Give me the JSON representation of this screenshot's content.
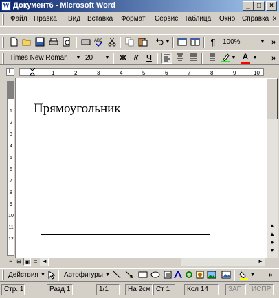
{
  "window": {
    "title": "Документ6 - Microsoft Word",
    "minimize": "_",
    "maximize": "□",
    "close": "×"
  },
  "menu": {
    "items": [
      "Файл",
      "Правка",
      "Вид",
      "Вставка",
      "Формат",
      "Сервис",
      "Таблица",
      "Окно",
      "Справка"
    ],
    "close_doc": "×",
    "more": "»"
  },
  "standard_toolbar": {
    "icons": [
      "new-icon",
      "open-icon",
      "save-icon",
      "print-icon",
      "print-preview-icon",
      "spelling-icon",
      "copy-icon",
      "paste-icon",
      "undo-icon",
      "table-icon",
      "columns-icon",
      "pilcrow-icon"
    ],
    "pilcrow": "¶",
    "zoom": "100%",
    "more": "»"
  },
  "format_toolbar": {
    "font": "Times New Roman",
    "size": "20",
    "bold": "Ж",
    "italic": "К",
    "underline": "Ч",
    "highlight_color": "#00ff00",
    "font_color": "#ff0000",
    "font_color_letter": "А",
    "more": "»"
  },
  "ruler": {
    "numbers": [
      "1",
      "2",
      "3",
      "4",
      "5",
      "6",
      "7",
      "8",
      "9",
      "10"
    ]
  },
  "vruler": {
    "numbers": [
      "1",
      "2",
      "3",
      "4",
      "5",
      "6",
      "7",
      "8",
      "9",
      "10",
      "11",
      "12"
    ]
  },
  "document": {
    "text": "Прямоугольник"
  },
  "drawing_toolbar": {
    "actions": "Действия",
    "autoshapes": "Автофигуры",
    "icons": [
      "line-icon",
      "arrow-icon",
      "rectangle-icon",
      "oval-icon",
      "textbox-icon",
      "wordart-icon",
      "diagram-icon",
      "clipart-icon",
      "picture-icon",
      "fill-color-icon"
    ],
    "fill_color": "#ffff00"
  },
  "status": {
    "page": "Стр. 1",
    "section": "Разд 1",
    "pages": "1/1",
    "at": "На 2см",
    "line": "Ст 1",
    "col": "Кол 14",
    "rec": "ЗАП",
    "trk": "ИСПР"
  }
}
